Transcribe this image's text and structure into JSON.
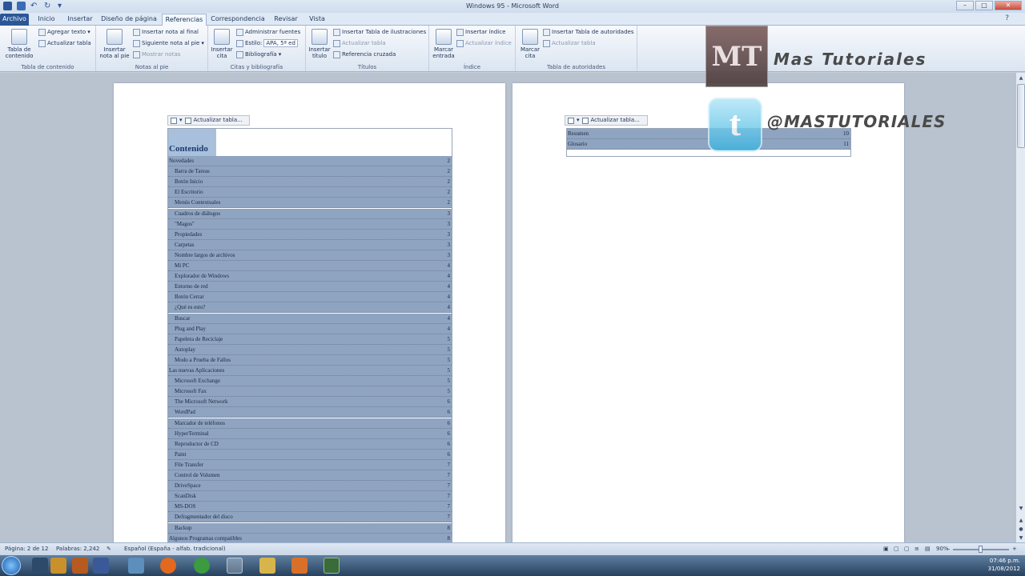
{
  "window": {
    "title": "Windows 95 - Microsoft Word"
  },
  "tabs": [
    {
      "label": "Archivo"
    },
    {
      "label": "Inicio"
    },
    {
      "label": "Insertar"
    },
    {
      "label": "Diseño de página"
    },
    {
      "label": "Referencias"
    },
    {
      "label": "Correspondencia"
    },
    {
      "label": "Revisar"
    },
    {
      "label": "Vista"
    }
  ],
  "ribbon": {
    "toc": {
      "big": "Tabla de contenido",
      "add_text": "Agregar texto",
      "update": "Actualizar tabla",
      "group": "Tabla de contenido"
    },
    "notes": {
      "big": "Insertar nota al pie",
      "endnote": "Insertar nota al final",
      "next": "Siguiente nota al pie",
      "show": "Mostrar notas",
      "group": "Notas al pie"
    },
    "citations": {
      "big": "Insertar cita",
      "manage": "Administrar fuentes",
      "style_label": "Estilo:",
      "style_value": "APA, 5ª ed",
      "biblio": "Bibliografía",
      "group": "Citas y bibliografía"
    },
    "captions": {
      "big": "Insertar título",
      "ins_fig": "Insertar Tabla de ilustraciones",
      "update": "Actualizar tabla",
      "crossref": "Referencia cruzada",
      "group": "Títulos"
    },
    "index": {
      "big": "Marcar entrada",
      "ins": "Insertar índice",
      "update": "Actualizar índice",
      "group": "Índice"
    },
    "authorities": {
      "big": "Marcar cita",
      "ins": "Insertar Tabla de autoridades",
      "update": "Actualizar tabla",
      "group": "Tabla de autoridades"
    }
  },
  "overlay": {
    "logo": "MT",
    "brand": "Mas Tutoriales",
    "twitter": "t",
    "handle": "@MASTUTORIALES"
  },
  "page1": {
    "field_label": "Actualizar tabla...",
    "toc_title": "Contenido",
    "entries": [
      {
        "text": "Novedades",
        "page": "2",
        "level": 1
      },
      {
        "text": "Barra de Tareas",
        "page": "2",
        "level": 2
      },
      {
        "text": "Botón Inicio",
        "page": "2",
        "level": 2
      },
      {
        "text": "El Escritorio",
        "page": "2",
        "level": 2
      },
      {
        "text": "Menús Contextuales",
        "page": "2",
        "level": 2
      },
      {
        "text": "Cuadros de diálogos",
        "page": "3",
        "level": 2
      },
      {
        "text": "\"Magos\"",
        "page": "3",
        "level": 2
      },
      {
        "text": "Propiedades",
        "page": "3",
        "level": 2
      },
      {
        "text": "Carpetas",
        "page": "3",
        "level": 2
      },
      {
        "text": "Nombre largos de archivos",
        "page": "3",
        "level": 2
      },
      {
        "text": "Mi PC",
        "page": "4",
        "level": 2
      },
      {
        "text": "Explorador de Windows",
        "page": "4",
        "level": 2
      },
      {
        "text": "Entorno de red",
        "page": "4",
        "level": 2
      },
      {
        "text": "Botón Cerrar",
        "page": "4",
        "level": 2
      },
      {
        "text": "¿Qué es esto?",
        "page": "4",
        "level": 2
      },
      {
        "text": "Buscar",
        "page": "4",
        "level": 2
      },
      {
        "text": "Plug and Play",
        "page": "4",
        "level": 2
      },
      {
        "text": "Papelera de Reciclaje",
        "page": "5",
        "level": 2
      },
      {
        "text": "Autoplay",
        "page": "5",
        "level": 2
      },
      {
        "text": "Modo a Prueba de Fallos",
        "page": "5",
        "level": 2
      },
      {
        "text": "Las nuevas Aplicaciones",
        "page": "5",
        "level": 1
      },
      {
        "text": "Microsoft Exchange",
        "page": "5",
        "level": 2
      },
      {
        "text": "Microsoft Fax",
        "page": "5",
        "level": 2
      },
      {
        "text": "The Microsoft Network",
        "page": "6",
        "level": 2
      },
      {
        "text": "WordPad",
        "page": "6",
        "level": 2
      },
      {
        "text": "Marcador de teléfonos",
        "page": "6",
        "level": 2
      },
      {
        "text": "HyperTerminal",
        "page": "6",
        "level": 2
      },
      {
        "text": "Reproductor de CD",
        "page": "6",
        "level": 2
      },
      {
        "text": "Paint",
        "page": "6",
        "level": 2
      },
      {
        "text": "File Transfer",
        "page": "7",
        "level": 2
      },
      {
        "text": "Control de Volumen",
        "page": "7",
        "level": 2
      },
      {
        "text": "DriveSpace",
        "page": "7",
        "level": 2
      },
      {
        "text": "ScanDisk",
        "page": "7",
        "level": 2
      },
      {
        "text": "MS-DOS",
        "page": "7",
        "level": 2
      },
      {
        "text": "Defragmentador del disco",
        "page": "7",
        "level": 2
      },
      {
        "text": "Backup",
        "page": "8",
        "level": 2
      },
      {
        "text": "Algunos Programas compatibles",
        "page": "8",
        "level": 1
      }
    ]
  },
  "page2": {
    "field_label": "Actualizar tabla...",
    "entries": [
      {
        "text": "Resumen",
        "page": "10"
      },
      {
        "text": "Glosario",
        "page": "11"
      }
    ]
  },
  "status": {
    "page": "Página: 2 de 12",
    "words": "Palabras: 2,242",
    "language": "Español (España - alfab. tradicional)",
    "zoom": "90%",
    "zoom_level": 0.5
  },
  "tray": {
    "time": "07:46 p.m.",
    "date": "31/08/2012"
  }
}
